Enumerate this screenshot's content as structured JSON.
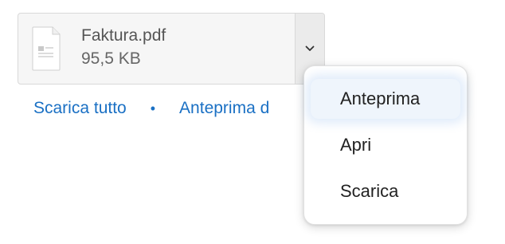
{
  "attachment": {
    "file_name": "Faktura.pdf",
    "file_size": "95,5 KB",
    "file_icon": "pdf-document-icon",
    "toggle_icon": "chevron-down-icon"
  },
  "links": {
    "download_all": "Scarica tutto",
    "separator": "•",
    "preview_all": "Anteprima d"
  },
  "menu": {
    "items": [
      {
        "label": "Anteprima"
      },
      {
        "label": "Apri"
      },
      {
        "label": "Scarica"
      }
    ]
  },
  "colors": {
    "link": "#1a70c4",
    "card_background": "#f6f6f6",
    "focus_glow": "#78aae6"
  }
}
